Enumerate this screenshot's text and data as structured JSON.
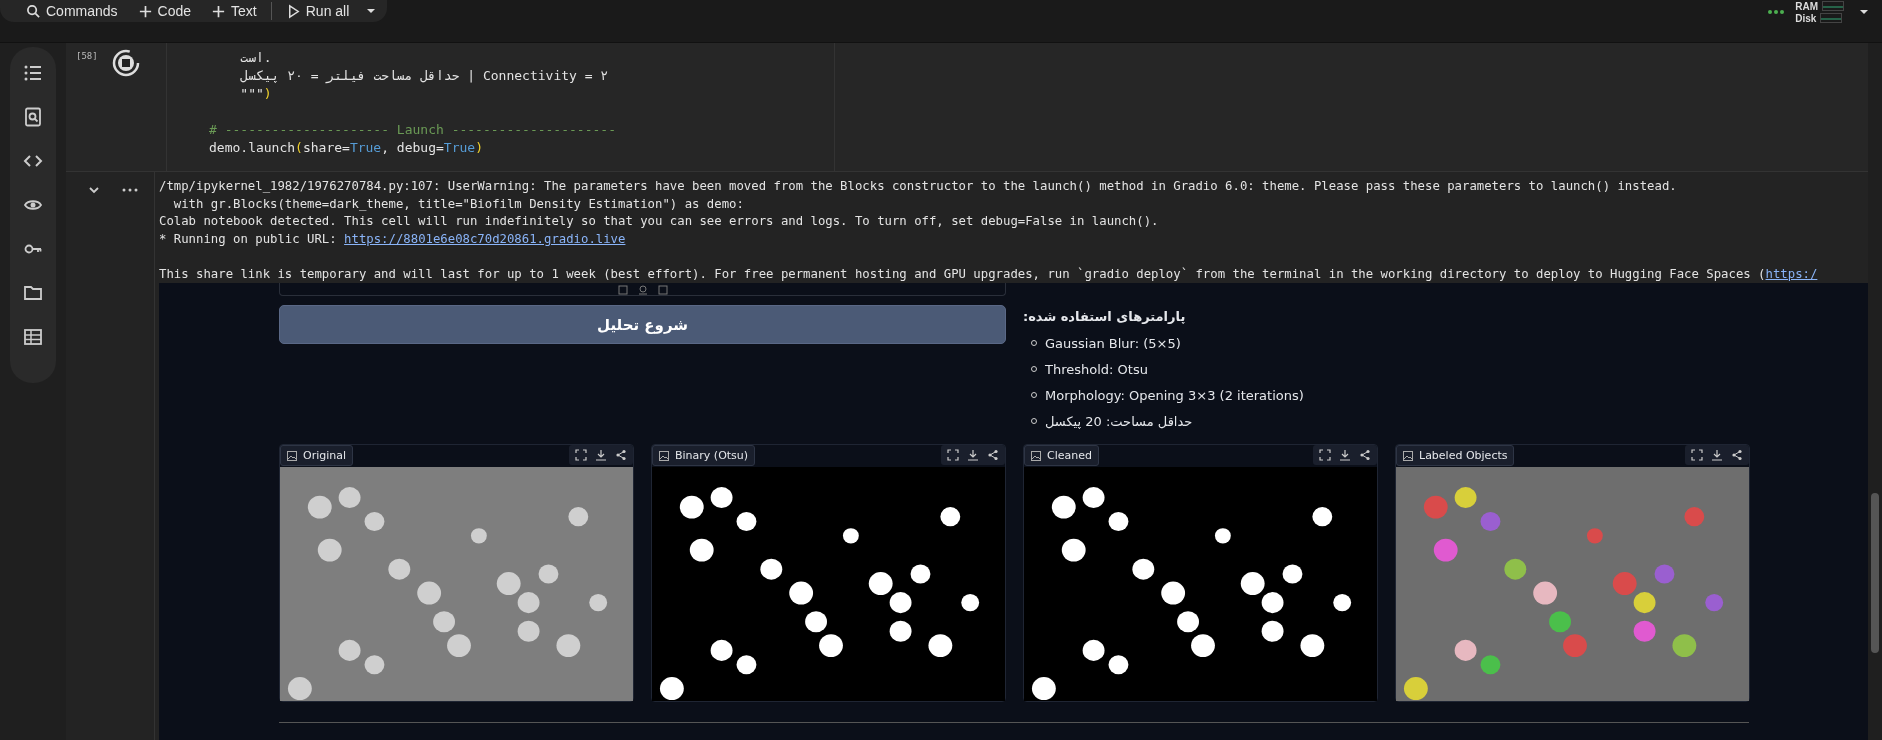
{
  "toolbar": {
    "commands": "Commands",
    "code": "Code",
    "text": "Text",
    "run_all": "Run all"
  },
  "resources": {
    "ram": "RAM",
    "disk": "Disk"
  },
  "cell": {
    "execution_count": "[58]",
    "code_blocks": [
      [
        [
          {
            "kind": "plain",
            "text": "    است."
          }
        ],
        [
          {
            "kind": "plain",
            "text": "    حداقل مساحت فیلتر = ۲۰ پیکسل | Connectivity = ۲"
          }
        ],
        [
          {
            "kind": "plain",
            "text": "    \"\"\""
          },
          {
            "kind": "paren",
            "text": ")"
          }
        ]
      ],
      [
        [
          {
            "kind": "comment",
            "text": "# --------------------- Launch ---------------------"
          }
        ],
        [
          {
            "kind": "plain",
            "text": "demo.launch"
          },
          {
            "kind": "paren",
            "text": "("
          },
          {
            "kind": "plain",
            "text": "share="
          },
          {
            "kind": "keyword",
            "text": "True"
          },
          {
            "kind": "plain",
            "text": ", debug="
          },
          {
            "kind": "keyword",
            "text": "True"
          },
          {
            "kind": "paren",
            "text": ")"
          }
        ]
      ]
    ]
  },
  "output": {
    "paragraphs": [
      [
        {
          "text": "/tmp/ipykernel_1982/1976270784.py:107: UserWarning: The parameters have been moved from the Blocks constructor to the launch() method in Gradio 6.0: theme. Please pass these parameters to launch() instead."
        },
        {
          "text": "  with gr.Blocks(theme=dark_theme, title=\"Biofilm Density Estimation\") as demo:"
        },
        {
          "text": "Colab notebook detected. This cell will run indefinitely so that you can see errors and logs. To turn off, set debug=False in launch()."
        },
        {
          "text": "* Running on public URL: ",
          "link": "https://8801e6e08c70d20861.gradio.live"
        }
      ],
      [
        {
          "text": "This share link is temporary and will last for up to 1 week (best effort). For free permanent hosting and GPU upgrades, run `gradio deploy` from the terminal in the working directory to deploy to Hugging Face Spaces (",
          "link": "https:/"
        }
      ]
    ]
  },
  "app": {
    "analyze_button": "شروع تحلیل",
    "params_title": "پارامترهای استفاده شده:",
    "params": [
      "Gaussian Blur: (5×5)",
      "Threshold: Otsu",
      "Morphology: Opening 3×3 (2 iterations)",
      "حداقل مساحت: 20 پیکسل"
    ],
    "images": [
      {
        "label": "Original",
        "kind": "gray"
      },
      {
        "label": "Binary (Otsu)",
        "kind": "binary"
      },
      {
        "label": "Cleaned",
        "kind": "binary"
      },
      {
        "label": "Labeled Objects",
        "kind": "labeled"
      }
    ]
  }
}
